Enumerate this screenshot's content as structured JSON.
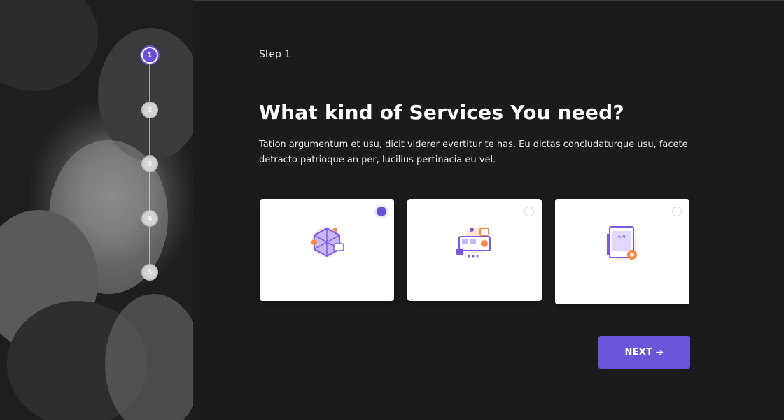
{
  "stepper": {
    "steps": [
      "1",
      "2",
      "3",
      "4",
      "5"
    ],
    "active_index": 0
  },
  "main": {
    "step_label": "Step 1",
    "title": "What kind of Services You need?",
    "description": "Tation argumentum et usu, dicit viderer evertitur te has. Eu dictas concludaturque usu, facete detracto patrioque an per, lucilius pertinacia eu vel."
  },
  "options": [
    {
      "icon": "network-cube-icon",
      "selected": true
    },
    {
      "icon": "dashboard-settings-icon",
      "selected": false
    },
    {
      "icon": "api-gear-icon",
      "selected": false
    }
  ],
  "footer": {
    "next_label": "NEXT",
    "next_icon": "arrow-right-icon"
  },
  "colors": {
    "accent": "#6a55d8",
    "background": "#1b1b1c",
    "card": "#ffffff"
  }
}
